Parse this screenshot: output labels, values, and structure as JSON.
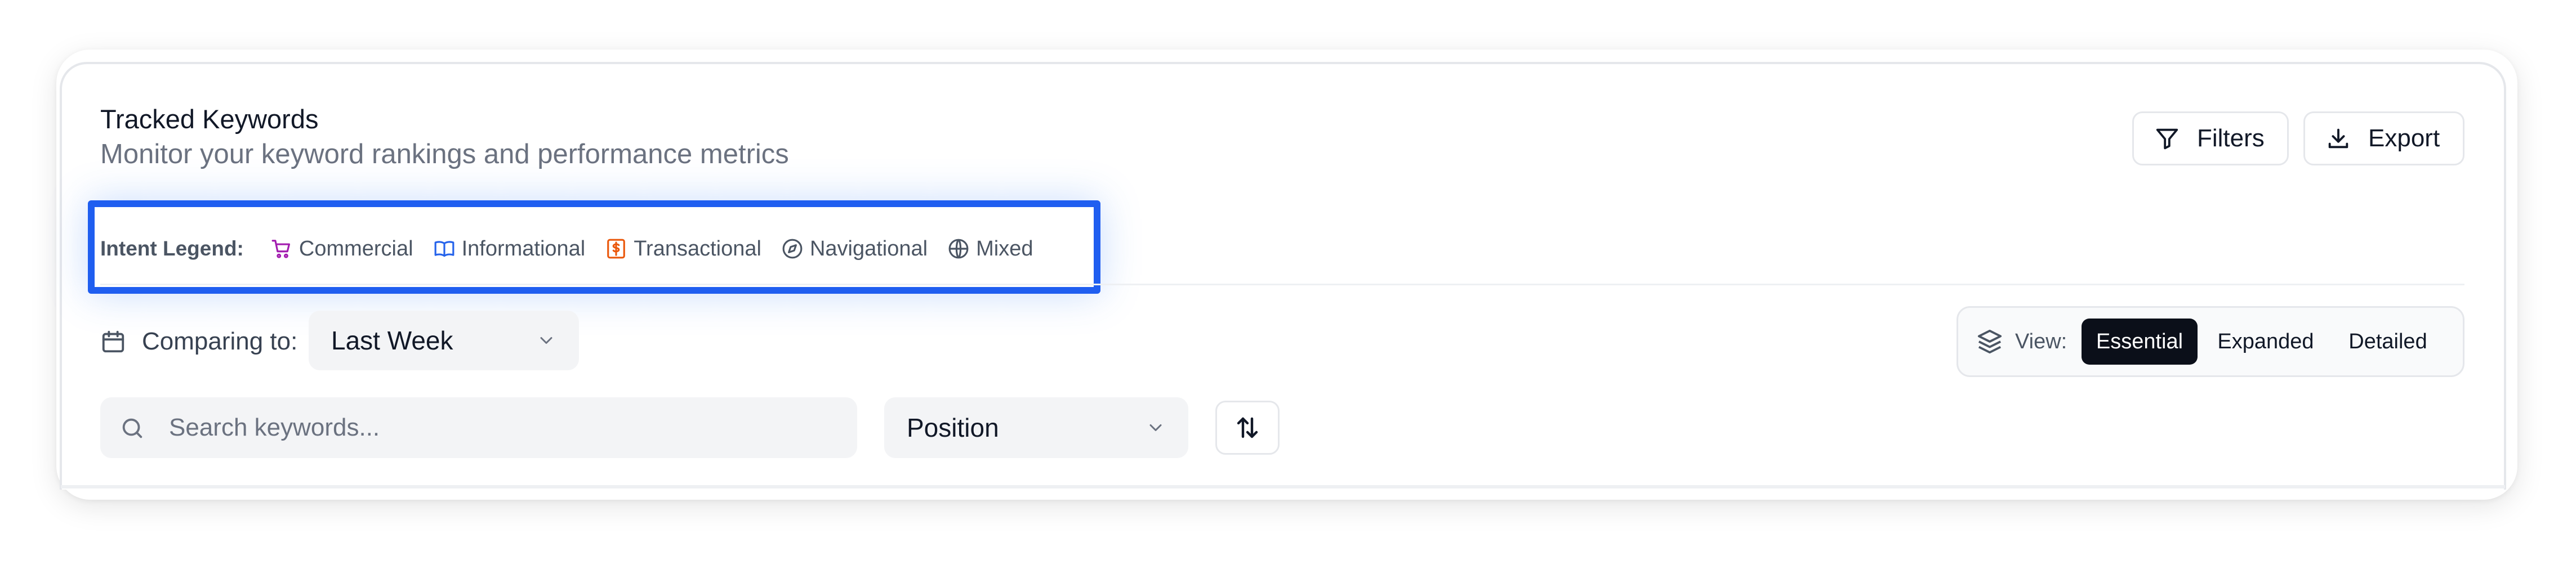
{
  "header": {
    "title": "Tracked Keywords",
    "subtitle": "Monitor your keyword rankings and performance metrics"
  },
  "actions": {
    "filters_label": "Filters",
    "export_label": "Export"
  },
  "legend": {
    "title": "Intent Legend:",
    "items": [
      {
        "label": "Commercial",
        "icon": "cart-icon",
        "color": "#a21caf"
      },
      {
        "label": "Informational",
        "icon": "book-icon",
        "color": "#2563eb"
      },
      {
        "label": "Transactional",
        "icon": "dollar-icon",
        "color": "#ea580c"
      },
      {
        "label": "Navigational",
        "icon": "compass-icon",
        "color": "#4b5563"
      },
      {
        "label": "Mixed",
        "icon": "globe-icon",
        "color": "#4b5563"
      }
    ]
  },
  "comparison": {
    "label": "Comparing to:",
    "selected": "Last Week"
  },
  "view": {
    "label": "View:",
    "tabs": [
      {
        "label": "Essential",
        "active": true
      },
      {
        "label": "Expanded",
        "active": false
      },
      {
        "label": "Detailed",
        "active": false
      }
    ]
  },
  "search": {
    "placeholder": "Search keywords...",
    "value": ""
  },
  "sort": {
    "selected": "Position"
  },
  "colors": {
    "highlight": "#1f5ef0",
    "active_tab_bg": "#0b0f19"
  }
}
